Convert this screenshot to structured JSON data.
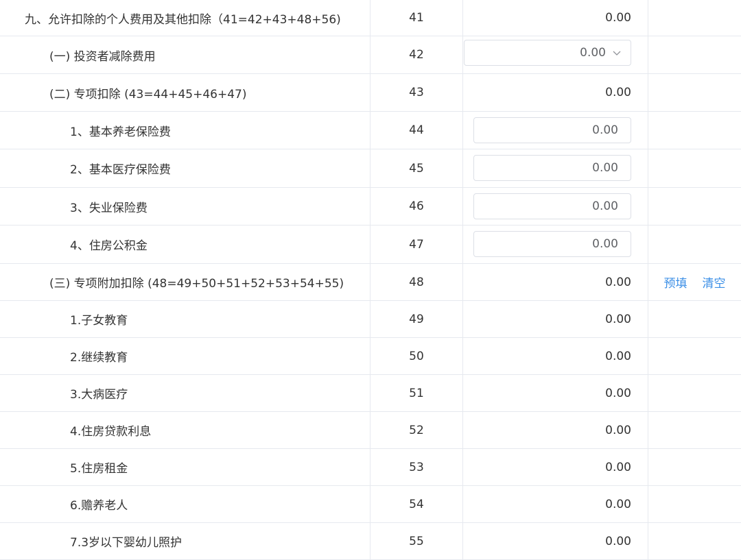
{
  "rows": [
    {
      "label": "九、允许扣除的个人费用及其他扣除（41=42+43+48+56)",
      "num": "41",
      "value": "0.00"
    },
    {
      "label": "(一) 投资者减除费用",
      "num": "42",
      "value": "0.00"
    },
    {
      "label": "(二) 专项扣除 (43=44+45+46+47)",
      "num": "43",
      "value": "0.00"
    },
    {
      "label": "1、基本养老保险费",
      "num": "44",
      "value": "0.00"
    },
    {
      "label": "2、基本医疗保险费",
      "num": "45",
      "value": "0.00"
    },
    {
      "label": "3、失业保险费",
      "num": "46",
      "value": "0.00"
    },
    {
      "label": "4、住房公积金",
      "num": "47",
      "value": "0.00"
    },
    {
      "label": "(三) 专项附加扣除 (48=49+50+51+52+53+54+55)",
      "num": "48",
      "value": "0.00",
      "actions": {
        "prefill": "预填",
        "clear": "清空"
      }
    },
    {
      "label": "1.子女教育",
      "num": "49",
      "value": "0.00"
    },
    {
      "label": "2.继续教育",
      "num": "50",
      "value": "0.00"
    },
    {
      "label": "3.大病医疗",
      "num": "51",
      "value": "0.00"
    },
    {
      "label": "4.住房贷款利息",
      "num": "52",
      "value": "0.00"
    },
    {
      "label": "5.住房租金",
      "num": "53",
      "value": "0.00"
    },
    {
      "label": "6.赡养老人",
      "num": "54",
      "value": "0.00"
    },
    {
      "label": "7.3岁以下婴幼儿照护",
      "num": "55",
      "value": "0.00"
    }
  ],
  "icons": {
    "select_chevron": "chevron-down-icon"
  },
  "colors": {
    "link": "#3a8ee6",
    "border": "#e6e9ef"
  }
}
